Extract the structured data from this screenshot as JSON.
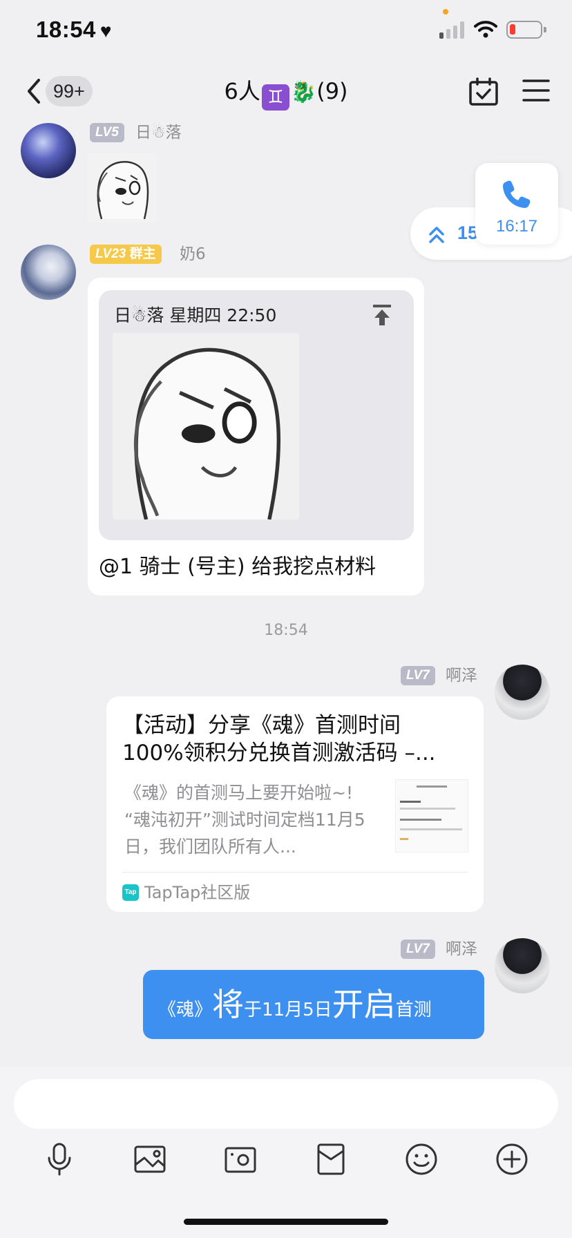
{
  "status_bar": {
    "time": "18:54",
    "heart": "♥"
  },
  "nav": {
    "badge": "99+",
    "title_prefix": "6人",
    "title_gem": "♊",
    "title_dragon": "🐉",
    "title_suffix": "(9)"
  },
  "floating": {
    "unread_count": "15",
    "call_time": "16:17"
  },
  "messages": {
    "m1": {
      "level": "LV5",
      "sender": "日☃落"
    },
    "m2": {
      "level": "LV23",
      "role": "群主",
      "sender": "奶6",
      "quote_header": "日☃落 星期四 22:50",
      "text": "@1 骑士 (号主) 给我挖点材料"
    },
    "time_separator": "18:54",
    "m3": {
      "level": "LV7",
      "sender": "啊泽",
      "card_title_line1": "【活动】分享《魂》首测时间",
      "card_title_line2": "100%领积分兑换首测激活码 –...",
      "card_desc_line1": "《魂》的首测马上要开始啦~!",
      "card_desc_line2": "“魂沌初开”测试时间定档11月5",
      "card_desc_line3": "日，我们团队所有人...",
      "card_logo": "Tap",
      "card_source": "TapTap社区版"
    },
    "m4": {
      "level": "LV7",
      "sender": "啊泽",
      "parts": [
        "《魂》",
        "将",
        "于11月5日",
        "开启",
        "首测"
      ]
    }
  },
  "colors": {
    "accent": "#3d8ff0",
    "gold_badge": "#f6c94a",
    "level_badge": "#b9bac8"
  },
  "icons": [
    "back-chevron-icon",
    "calendar-check-icon",
    "menu-icon",
    "double-chevron-up-icon",
    "phone-icon",
    "pin-top-icon",
    "microphone-icon",
    "image-icon",
    "camera-icon",
    "red-packet-icon",
    "emoji-icon",
    "plus-circle-icon"
  ]
}
